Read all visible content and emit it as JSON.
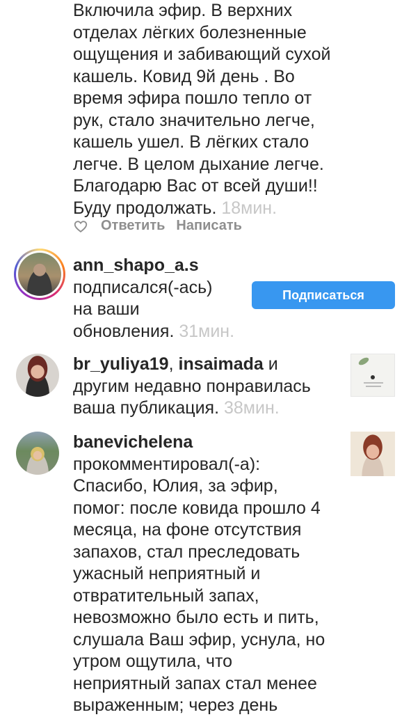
{
  "comment_continued": {
    "lines": [
      "Включила эфир. В верхних",
      "отделах лёгких болезненные",
      "ощущения и забивающий сухой",
      "кашель. Ковид 9й день . Во",
      "время эфира пошло тепло от",
      "рук, стало значительно легче,",
      "кашель ушел. В лёгких стало",
      "легче. В целом дыхание легче.",
      "Благодарю Вас от всей души!!",
      "Буду продолжать."
    ],
    "time": "18мин.",
    "actions": {
      "reply": "Ответить",
      "message": "Написать"
    }
  },
  "notifications": [
    {
      "username": "ann_shapo_a.s",
      "lines": [
        "подписался(-ась)",
        "на ваши",
        "обновления."
      ],
      "time": "31мин.",
      "button": "Подписаться"
    },
    {
      "username": "br_yuliya19",
      "sep": ",",
      "username2": "insaimada",
      "after": " и",
      "lines": [
        "другим недавно понравилась",
        "ваша публикация."
      ],
      "time": "38мин."
    },
    {
      "username": "banevichelena",
      "lines": [
        "прокомментировал(-а):",
        "Спасибо, Юлия, за эфир,",
        "помог: после ковида прошло 4",
        "месяца, на фоне отсутствия",
        "запахов, стал преследовать",
        "ужасный неприятный и",
        "отвратительный запах,",
        "невозможно было есть и пить,",
        "слушала Ваш эфир, уснула, но",
        "утром ощутила, что",
        "неприятный запах стал менее",
        "выраженным; через день"
      ]
    }
  ],
  "colors": {
    "accent": "#3897f0",
    "muted": "#c7c7c7",
    "secondary": "#8e8e8e"
  }
}
